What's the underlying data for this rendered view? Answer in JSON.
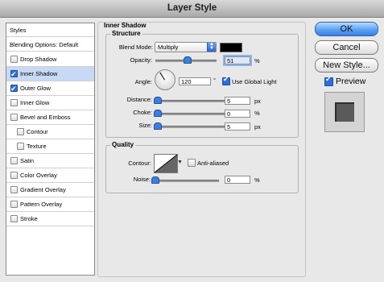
{
  "window": {
    "title": "Layer Style"
  },
  "sidebar": {
    "header": "Styles",
    "blending_options": "Blending Options: Default",
    "items": [
      {
        "label": "Drop Shadow",
        "checked": false,
        "selected": false
      },
      {
        "label": "Inner Shadow",
        "checked": true,
        "selected": true
      },
      {
        "label": "Outer Glow",
        "checked": true,
        "selected": false
      },
      {
        "label": "Inner Glow",
        "checked": false,
        "selected": false
      },
      {
        "label": "Bevel and Emboss",
        "checked": false,
        "selected": false
      },
      {
        "label": "Contour",
        "checked": false,
        "selected": false
      },
      {
        "label": "Texture",
        "checked": false,
        "selected": false
      },
      {
        "label": "Satin",
        "checked": false,
        "selected": false
      },
      {
        "label": "Color Overlay",
        "checked": false,
        "selected": false
      },
      {
        "label": "Gradient Overlay",
        "checked": false,
        "selected": false
      },
      {
        "label": "Pattern Overlay",
        "checked": false,
        "selected": false
      },
      {
        "label": "Stroke",
        "checked": false,
        "selected": false
      }
    ]
  },
  "panel": {
    "title": "Inner Shadow",
    "structure": {
      "title": "Structure",
      "blend_mode_label": "Blend Mode:",
      "blend_mode_value": "Multiply",
      "shadow_color": "#000000",
      "opacity_label": "Opacity:",
      "opacity_value": "51",
      "opacity_unit": "%",
      "angle_label": "Angle:",
      "angle_value": "120",
      "angle_unit": "°",
      "use_global_light_label": "Use Global Light",
      "use_global_light_checked": true,
      "distance_label": "Distance:",
      "distance_value": "5",
      "distance_unit": "px",
      "choke_label": "Choke:",
      "choke_value": "0",
      "choke_unit": "%",
      "size_label": "Size:",
      "size_value": "5",
      "size_unit": "px"
    },
    "quality": {
      "title": "Quality",
      "contour_label": "Contour:",
      "anti_aliased_label": "Anti-aliased",
      "anti_aliased_checked": false,
      "noise_label": "Noise:",
      "noise_value": "0",
      "noise_unit": "%"
    }
  },
  "buttons": {
    "ok": "OK",
    "cancel": "Cancel",
    "new_style": "New Style...",
    "preview_label": "Preview",
    "preview_checked": true
  },
  "colors": {
    "accent": "#3b82e4",
    "selection": "#c7d9f3"
  }
}
